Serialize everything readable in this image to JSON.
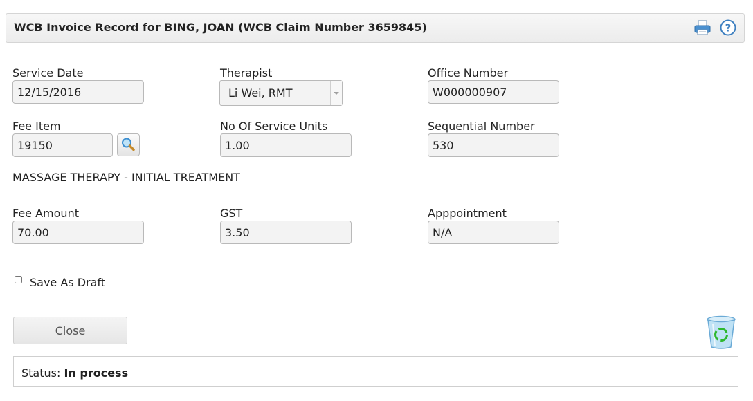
{
  "header": {
    "title_prefix": "WCB Invoice Record for BING, JOAN (WCB Claim Number ",
    "claim_number": "3659845",
    "title_suffix": ")",
    "print_icon": "printer-icon",
    "help_icon": "help-icon"
  },
  "form": {
    "service_date": {
      "label": "Service Date",
      "value": "12/15/2016"
    },
    "therapist": {
      "label": "Therapist",
      "value": "Li Wei, RMT"
    },
    "office_number": {
      "label": "Office Number",
      "value": "W000000907"
    },
    "fee_item": {
      "label": "Fee Item",
      "value": "19150",
      "lookup_icon": "magnifier-icon"
    },
    "service_units": {
      "label": "No Of Service Units",
      "value": "1.00"
    },
    "sequential_number": {
      "label": "Sequential Number",
      "value": "530"
    },
    "fee_description": "MASSAGE THERAPY - INITIAL TREATMENT",
    "fee_amount": {
      "label": "Fee Amount",
      "value": "70.00"
    },
    "gst": {
      "label": "GST",
      "value": "3.50"
    },
    "appointment": {
      "label": "Apppointment",
      "value": "N/A"
    },
    "save_as_draft": {
      "label": "Save As Draft",
      "checked": false
    }
  },
  "actions": {
    "close_label": "Close",
    "delete_icon": "recycle-bin-icon"
  },
  "status": {
    "label": "Status:",
    "value": "In process"
  },
  "colors": {
    "field_bg": "#f3f3f3",
    "field_border": "#b9b9b9",
    "header_bg": "#ececec",
    "icon_blue": "#3d8fd1",
    "recycle_green": "#2eb82e"
  }
}
